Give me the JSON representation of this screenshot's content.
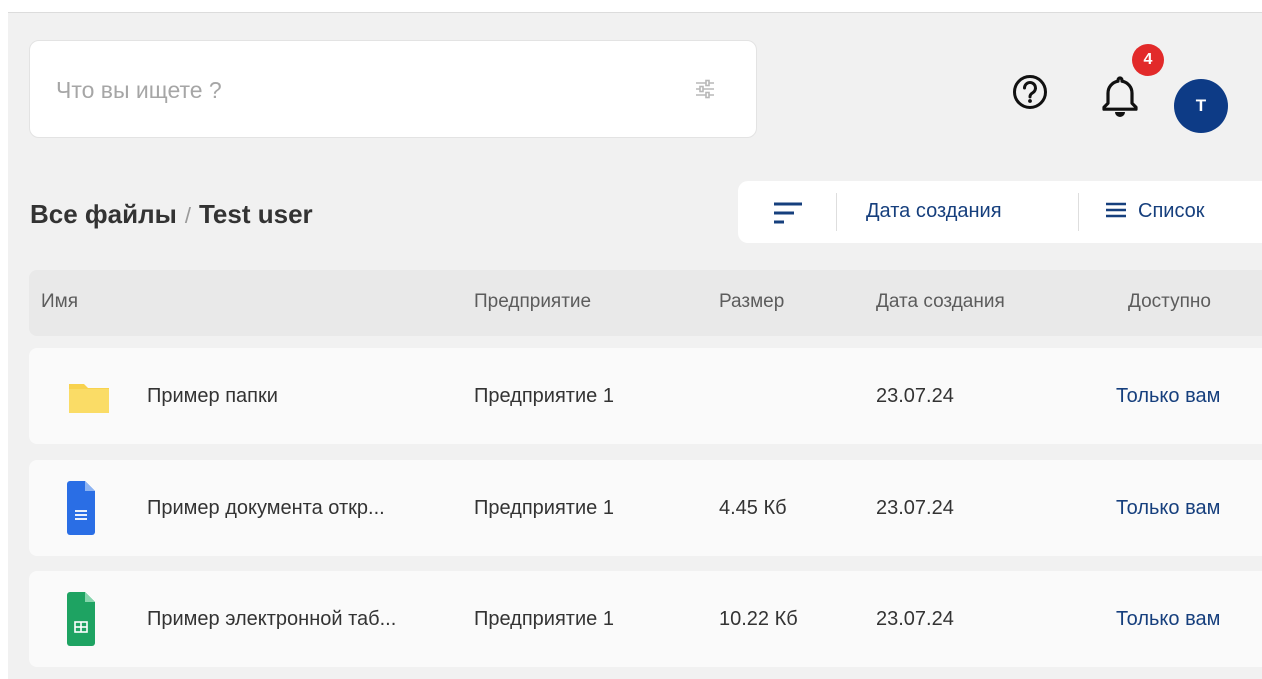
{
  "search": {
    "placeholder": "Что вы ищете ?"
  },
  "header": {
    "notifications_count": "4",
    "avatar_initial": "T"
  },
  "breadcrumb": {
    "root": "Все файлы",
    "separator": "/",
    "current": "Test user"
  },
  "toolbar": {
    "sort_label": "Дата создания",
    "view_label": "Список"
  },
  "table": {
    "columns": [
      "Имя",
      "Предприятие",
      "Размер",
      "Дата создания",
      "Доступно"
    ],
    "rows": [
      {
        "type": "folder",
        "name": "Пример папки",
        "company": "Предприятие 1",
        "size": "",
        "date": "23.07.24",
        "access": "Только вам"
      },
      {
        "type": "document",
        "name": "Пример документа откр...",
        "company": "Предприятие 1",
        "size": "4.45 Кб",
        "date": "23.07.24",
        "access": "Только вам"
      },
      {
        "type": "spreadsheet",
        "name": "Пример электронной таб...",
        "company": "Предприятие 1",
        "size": "10.22 Кб",
        "date": "23.07.24",
        "access": "Только вам"
      }
    ]
  },
  "icons": {
    "filter": "sliders-icon",
    "help": "question-circle-icon",
    "bell": "bell-icon",
    "sort": "sort-lines-icon",
    "view": "menu-lines-icon",
    "folder": "folder-icon",
    "document": "document-icon",
    "spreadsheet": "spreadsheet-icon"
  },
  "colors": {
    "background": "#f1f1f1",
    "accent": "#163f7d",
    "avatar": "#0d3b86",
    "badge": "#e22a2a",
    "folder": "#f8d24e",
    "document": "#2a6ee5",
    "spreadsheet": "#1ea362"
  }
}
